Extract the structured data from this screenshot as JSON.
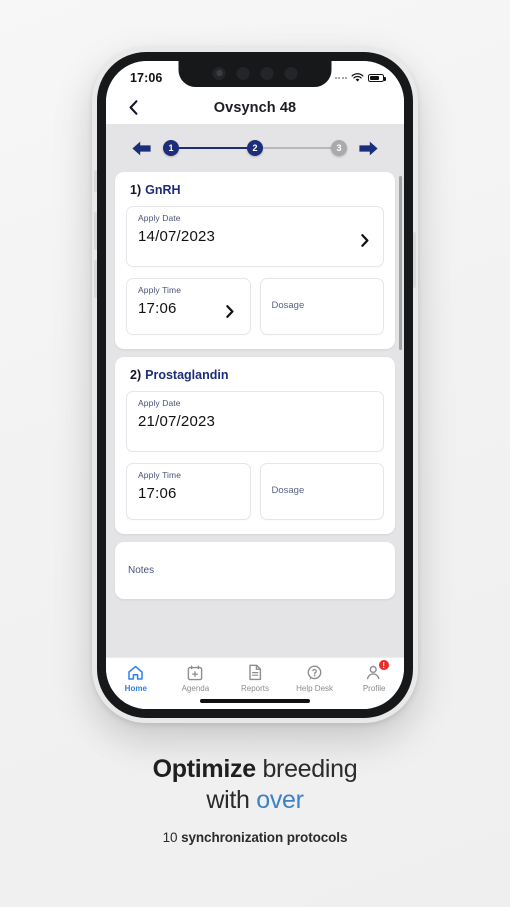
{
  "status_bar": {
    "time": "17:06",
    "signal_icon": "signal-dots-icon",
    "wifi_icon": "wifi-icon",
    "battery_icon": "battery-icon"
  },
  "header": {
    "back_icon": "chevron-left-icon",
    "title": "Ovsynch 48"
  },
  "stepper": {
    "prev_icon": "arrow-left-icon",
    "next_icon": "arrow-right-icon",
    "active_color": "#1c2e7a",
    "inactive_color": "#aaaaad",
    "steps": [
      {
        "label": "1",
        "state": "active"
      },
      {
        "label": "2",
        "state": "active"
      },
      {
        "label": "3",
        "state": "inactive"
      }
    ]
  },
  "protocols": [
    {
      "index": "1)",
      "name": "GnRH",
      "apply_date_label": "Apply Date",
      "apply_date_value": "14/07/2023",
      "apply_time_label": "Apply Time",
      "apply_time_value": "17:06",
      "dosage_placeholder": "Dosage",
      "chevron_icon": "chevron-right-icon"
    },
    {
      "index": "2)",
      "name": "Prostaglandin",
      "apply_date_label": "Apply Date",
      "apply_date_value": "21/07/2023",
      "apply_time_label": "Apply Time",
      "apply_time_value": "17:06",
      "dosage_placeholder": "Dosage",
      "chevron_icon": "chevron-right-icon"
    }
  ],
  "notes": {
    "placeholder": "Notes"
  },
  "tab_bar": {
    "items": [
      {
        "label": "Home",
        "icon": "home-icon",
        "active": true
      },
      {
        "label": "Agenda",
        "icon": "calendar-plus-icon",
        "active": false
      },
      {
        "label": "Reports",
        "icon": "document-icon",
        "active": false
      },
      {
        "label": "Help Desk",
        "icon": "question-bubble-icon",
        "active": false
      },
      {
        "label": "Profile",
        "icon": "user-icon",
        "active": false,
        "badge": "!"
      }
    ],
    "active_color": "#2f80ed",
    "badge_color": "#ee2b27"
  },
  "caption": {
    "line1_bold": "Optimize",
    "line1_rest": " breeding",
    "line2_rest": "with ",
    "line2_accent": "over",
    "sub_prefix": "10 ",
    "sub_bold": "synchronization protocols",
    "accent_color": "#3d82c4"
  }
}
